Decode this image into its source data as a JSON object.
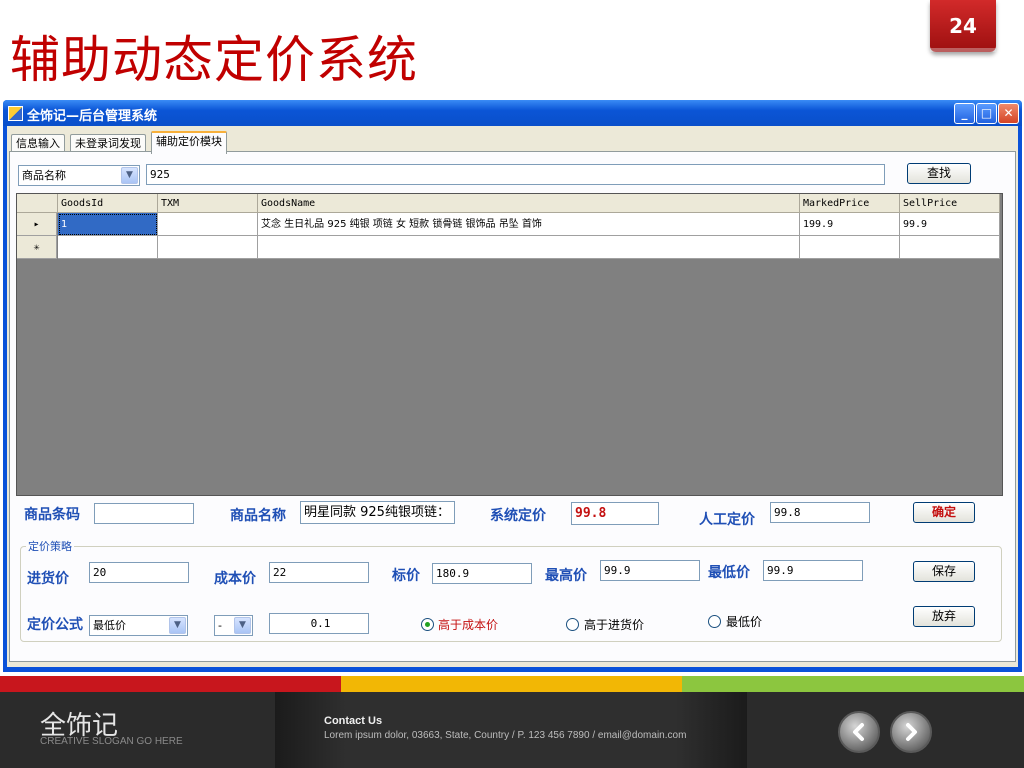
{
  "slide": {
    "title": "辅助动态定价系统",
    "page_number": "24"
  },
  "window": {
    "title": "全饰记—后台管理系统",
    "controls": {
      "minimize": "_",
      "maximize": "□",
      "close": "✕"
    }
  },
  "tabs": [
    {
      "label": "信息输入",
      "active": false
    },
    {
      "label": "未登录词发现",
      "active": false
    },
    {
      "label": "辅助定价模块",
      "active": true
    }
  ],
  "search": {
    "field_select": "商品名称",
    "query": "925",
    "button": "查找"
  },
  "grid": {
    "columns": [
      "GoodsId",
      "TXM",
      "GoodsName",
      "MarkedPrice",
      "SellPrice"
    ],
    "rows": [
      {
        "marker": "▸",
        "cells": [
          "1",
          "",
          "艾念 生日礼品 925 纯银 项链 女 短款 锁骨链 银饰品 吊坠 首饰",
          "199.9",
          "99.9"
        ]
      },
      {
        "marker": "✳",
        "cells": [
          "",
          "",
          "",
          "",
          ""
        ]
      }
    ]
  },
  "form": {
    "barcode_label": "商品条码",
    "barcode_value": "",
    "name_label": "商品名称",
    "name_value": "明星同款 925纯银项链：",
    "system_price_label": "系统定价",
    "system_price_value": "99.8",
    "manual_price_label": "人工定价",
    "manual_price_value": "99.8",
    "confirm_button": "确定"
  },
  "strategy": {
    "group_title": "定价策略",
    "purchase_label": "进货价",
    "purchase_value": "20",
    "cost_label": "成本价",
    "cost_value": "22",
    "list_label": "标价",
    "list_value": "180.9",
    "max_label": "最高价",
    "max_value": "99.9",
    "min_label": "最低价",
    "min_value": "99.9",
    "save_button": "保存",
    "formula_label": "定价公式",
    "formula_select": "最低价",
    "operator_select": "-",
    "factor_value": "0.1",
    "radio_options": [
      {
        "label": "高于成本价",
        "selected": true
      },
      {
        "label": "高于进货价",
        "selected": false
      },
      {
        "label": "最低价",
        "selected": false
      }
    ],
    "discard_button": "放弃"
  },
  "footer": {
    "brand": "全饰记",
    "slogan": "CREATIVE SLOGAN GO HERE",
    "contact_title": "Contact Us",
    "contact_text": "Lorem ipsum dolor, 03663, State, Country / P.  123 456 7890 / email@domain.com",
    "prev_icon": "chevron-left-icon",
    "next_icon": "chevron-right-icon"
  },
  "colors": {
    "title_red": "#c00000",
    "label_blue": "#1f4fb5",
    "stripe_red": "#c8161d",
    "stripe_yellow": "#f2b705",
    "stripe_green": "#8cc63f"
  }
}
